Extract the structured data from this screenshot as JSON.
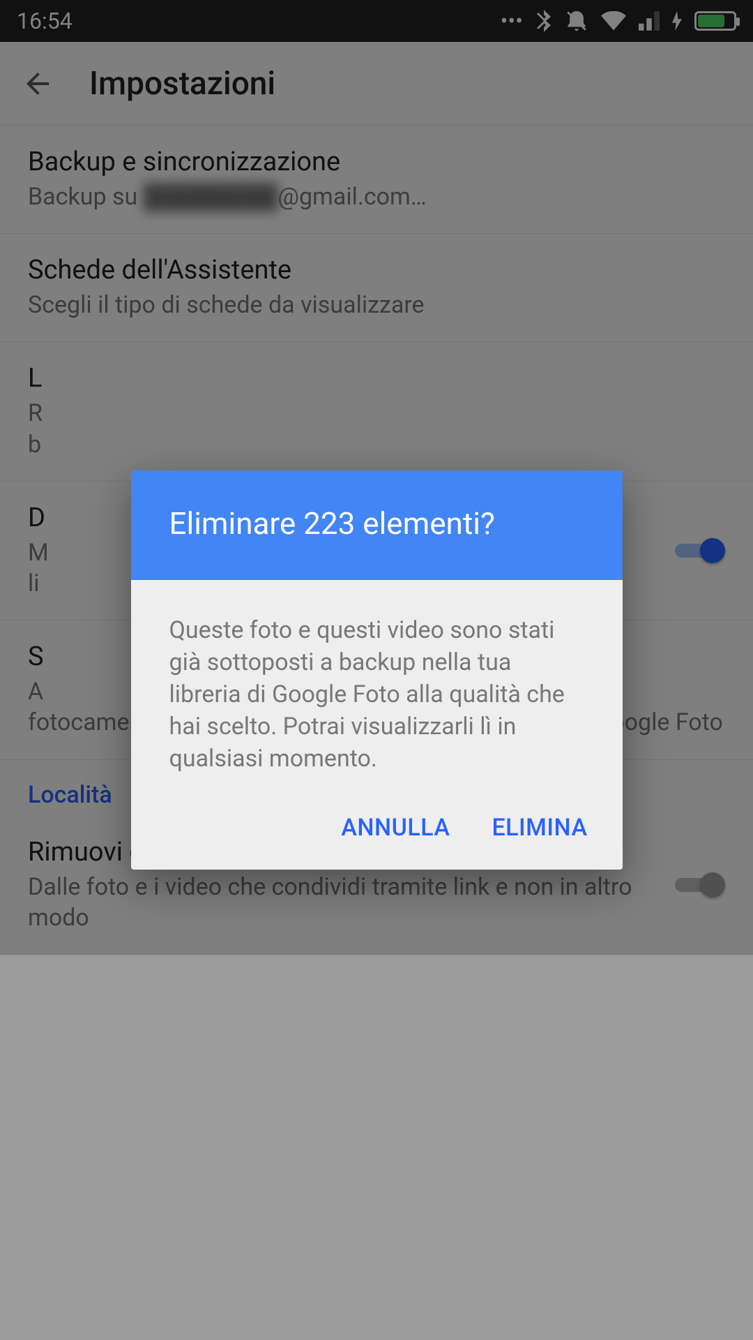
{
  "status": {
    "time": "16:54"
  },
  "appbar": {
    "title": "Impostazioni"
  },
  "settings": {
    "backup": {
      "title": "Backup e sincronizzazione",
      "sub_pre": "Backup su ",
      "sub_hidden": "████████",
      "sub_post": "@gmail.com…"
    },
    "assistant": {
      "title": "Schede dell'Assistente",
      "sub": "Scegli il tipo di schede da visualizzare"
    },
    "group": {
      "title": "L",
      "sub1": "R",
      "sub2": "b"
    },
    "drive": {
      "title": "D",
      "sub1": "M",
      "sub2": "li"
    },
    "camera": {
      "title": "S",
      "sub1": "A",
      "sub2": "fotocamera che ti permetta di passare direttamente a Google Foto"
    },
    "section_loc": "Località",
    "geo": {
      "title": "Rimuovi geolocalizzazione",
      "sub": "Dalle foto e i video che condividi tramite link e non in altro modo"
    }
  },
  "dialog": {
    "title": "Eliminare 223 elementi?",
    "body": "Queste foto e questi video sono stati già sottoposti a backup nella tua libreria di Google Foto alla qualità che hai scelto. Potrai visualizzarli lì in qualsiasi momento.",
    "cancel": "ANNULLA",
    "confirm": "ELIMINA"
  }
}
